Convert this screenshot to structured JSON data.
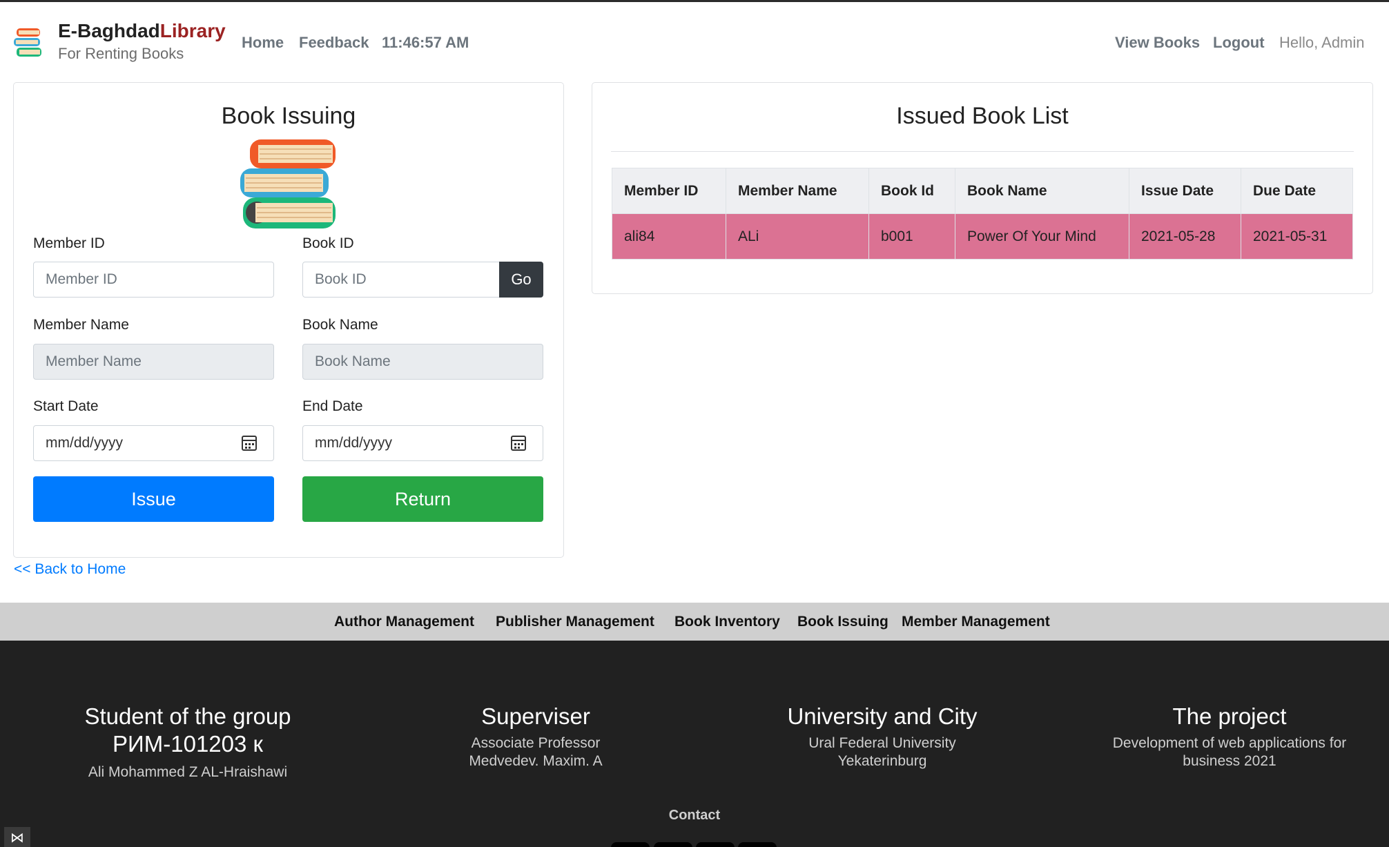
{
  "nav": {
    "brand_part1": "E-Baghdad",
    "brand_part2": "Library",
    "subtitle": "For Renting Books",
    "home": "Home",
    "feedback": "Feedback",
    "clock": "11:46:57 AM",
    "view_books": "View Books",
    "logout": "Logout",
    "hello": "Hello, Admin"
  },
  "issue_form": {
    "title": "Book Issuing",
    "member_id_label": "Member ID",
    "member_id_placeholder": "Member ID",
    "book_id_label": "Book ID",
    "book_id_placeholder": "Book ID",
    "go_label": "Go",
    "member_name_label": "Member Name",
    "member_name_placeholder": "Member Name",
    "book_name_label": "Book Name",
    "book_name_placeholder": "Book Name",
    "start_date_label": "Start Date",
    "start_date_value": "mm/dd/yyyy",
    "end_date_label": "End Date",
    "end_date_value": "mm/dd/yyyy",
    "issue_label": "Issue",
    "return_label": "Return",
    "back_link": "<< Back to Home"
  },
  "issued_list": {
    "title": "Issued Book List",
    "columns": [
      "Member ID",
      "Member Name",
      "Book Id",
      "Book Name",
      "Issue Date",
      "Due Date"
    ],
    "rows": [
      [
        "ali84",
        "ALi",
        "b001",
        "Power Of Your Mind",
        "2021-05-28",
        "2021-05-31"
      ]
    ],
    "overdue_row_color": "#db7293"
  },
  "admin_links": [
    "Author Management",
    "Publisher Management",
    "Book Inventory",
    "Book Issuing",
    "Member Management"
  ],
  "footer": {
    "col1_title_line1": "Student of the group",
    "col1_title_line2": "РИМ-101203 к",
    "col1_text": "Ali Mohammed Z AL-Hraishawi",
    "col2_title": "Superviser",
    "col2_line1": "Associate Professor",
    "col2_line2": "Medvedev. Maxim. A",
    "col3_title": "University and City",
    "col3_line1": "Ural Federal University",
    "col3_line2": "Yekaterinburg",
    "col4_title": "The project",
    "col4_line1": "Development of web applications for",
    "col4_line2": "business 2021",
    "contact": "Contact"
  },
  "colors": {
    "primary": "#007bff",
    "success": "#28a745",
    "dark": "#343a40",
    "brand_accent": "#9b2222",
    "footer_bg": "#212121"
  },
  "icons": {
    "logo": "books-stack-icon",
    "calendar": "calendar-icon",
    "devtools": "visual-studio-icon"
  }
}
